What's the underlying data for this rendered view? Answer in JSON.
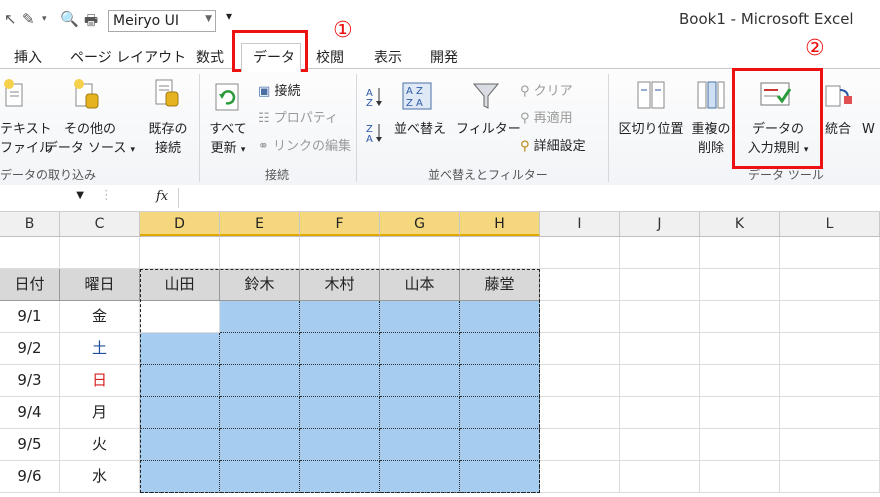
{
  "window": {
    "title": "Book1 - Microsoft Excel"
  },
  "qat": {
    "font_name": "Meiryo UI",
    "more": "▾"
  },
  "tabs": [
    "挿入",
    "ページ レイアウト",
    "数式",
    "データ",
    "校閲",
    "表示",
    "開発"
  ],
  "active_tab": "データ",
  "annotations": {
    "one": "①",
    "two": "②",
    "color": "#ee1111"
  },
  "ribbon": {
    "get_external": {
      "text_file_1": "テキスト",
      "text_file_2": "ファイル",
      "other_1": "その他の",
      "other_2": "データ ソース",
      "group": "データの取り込み"
    },
    "connections": {
      "existing_1": "既存の",
      "existing_2": "接続",
      "refresh_1": "すべて",
      "refresh_2": "更新",
      "connections": "接続",
      "properties": "プロパティ",
      "edit_links": "リンクの編集",
      "group": "接続"
    },
    "sort_filter": {
      "sort": "並べ替え",
      "filter": "フィルター",
      "clear": "クリア",
      "reapply": "再適用",
      "advanced": "詳細設定",
      "group": "並べ替えとフィルター"
    },
    "data_tools": {
      "text_to_columns": "区切り位置",
      "remove_dup_1": "重複の",
      "remove_dup_2": "削除",
      "validation_1": "データの",
      "validation_2": "入力規則",
      "consolidate": "統合",
      "w": "W",
      "group": "データ ツール"
    }
  },
  "formula_bar": {
    "fx": "fx"
  },
  "columns": [
    "B",
    "C",
    "D",
    "E",
    "F",
    "G",
    "H",
    "I",
    "J",
    "K",
    "L"
  ],
  "selected_columns": [
    "D",
    "E",
    "F",
    "G",
    "H"
  ],
  "table": {
    "headers": [
      "日付",
      "曜日",
      "山田",
      "鈴木",
      "木村",
      "山本",
      "藤堂"
    ],
    "rows": [
      {
        "date": "9/1",
        "day": "金",
        "color": "#222222"
      },
      {
        "date": "9/2",
        "day": "土",
        "color": "#1f4e9c"
      },
      {
        "date": "9/3",
        "day": "日",
        "color": "#d62020"
      },
      {
        "date": "9/4",
        "day": "月",
        "color": "#222222"
      },
      {
        "date": "9/5",
        "day": "火",
        "color": "#222222"
      },
      {
        "date": "9/6",
        "day": "水",
        "color": "#222222"
      }
    ],
    "selection_color": "#a6cdf0"
  }
}
